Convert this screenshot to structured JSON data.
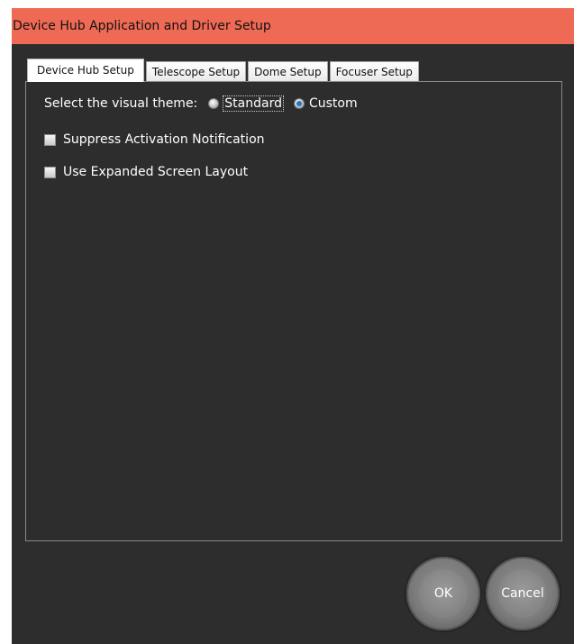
{
  "window": {
    "title": "Device Hub Application and Driver Setup"
  },
  "tabs": [
    {
      "label": "Device Hub Setup",
      "selected": true
    },
    {
      "label": "Telescope Setup",
      "selected": false
    },
    {
      "label": "Dome Setup",
      "selected": false
    },
    {
      "label": "Focuser Setup",
      "selected": false
    }
  ],
  "device_hub_setup": {
    "theme_label": "Select the visual theme:",
    "theme_options": [
      {
        "label": "Standard",
        "checked": false
      },
      {
        "label": "Custom",
        "checked": true
      }
    ],
    "suppress_activation": {
      "label": "Suppress Activation Notification",
      "checked": false
    },
    "expanded_layout": {
      "label": "Use Expanded Screen Layout",
      "checked": false
    }
  },
  "buttons": {
    "ok": "OK",
    "cancel": "Cancel"
  },
  "colors": {
    "titlebar": "#ef6a55",
    "background": "#2d2d2d",
    "radio_selected": "#1f78c8"
  },
  "icons": {
    "radio_unchecked": "radio-unchecked-icon",
    "radio_checked": "radio-checked-icon",
    "checkbox_unchecked": "checkbox-unchecked-icon"
  }
}
